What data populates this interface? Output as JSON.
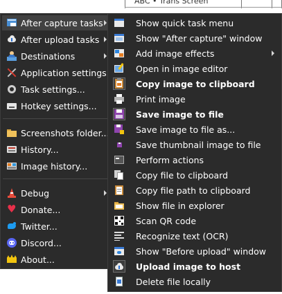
{
  "background_window": {
    "text": "ABC • Trans Screen"
  },
  "main_menu": {
    "items": [
      {
        "label": "After capture tasks",
        "icon": "after-capture-icon",
        "submenu": true
      },
      {
        "label": "After upload tasks",
        "icon": "after-upload-icon",
        "submenu": true
      },
      {
        "label": "Destinations",
        "icon": "destinations-icon",
        "submenu": true
      },
      {
        "label": "Application settings...",
        "icon": "wrench-icon"
      },
      {
        "label": "Task settings...",
        "icon": "gear-icon"
      },
      {
        "label": "Hotkey settings...",
        "icon": "keyboard-icon"
      },
      {
        "label": "Screenshots folder...",
        "icon": "folder-icon"
      },
      {
        "label": "History...",
        "icon": "history-icon"
      },
      {
        "label": "Image history...",
        "icon": "image-history-icon"
      },
      {
        "label": "Debug",
        "icon": "traffic-cone-icon",
        "submenu": true
      },
      {
        "label": "Donate...",
        "icon": "heart-icon"
      },
      {
        "label": "Twitter...",
        "icon": "twitter-bird-icon"
      },
      {
        "label": "Discord...",
        "icon": "discord-icon"
      },
      {
        "label": "About...",
        "icon": "crown-icon"
      }
    ]
  },
  "submenu": {
    "items": [
      {
        "label": "Show quick task menu",
        "icon": "quick-task-menu-icon"
      },
      {
        "label": "Show \"After capture\" window",
        "icon": "window-icon"
      },
      {
        "label": "Add image effects",
        "icon": "image-effects-icon",
        "submenu": true
      },
      {
        "label": "Open in image editor",
        "icon": "image-editor-icon"
      },
      {
        "label": "Copy image to clipboard",
        "icon": "clipboard-image-icon",
        "checked": true
      },
      {
        "label": "Print image",
        "icon": "printer-icon"
      },
      {
        "label": "Save image to file",
        "icon": "floppy-disk-icon",
        "checked": true
      },
      {
        "label": "Save image to file as...",
        "icon": "floppy-disk-as-icon"
      },
      {
        "label": "Save thumbnail image to file",
        "icon": "thumbnail-icon"
      },
      {
        "label": "Perform actions",
        "icon": "terminal-icon"
      },
      {
        "label": "Copy file to clipboard",
        "icon": "copy-file-icon"
      },
      {
        "label": "Copy file path to clipboard",
        "icon": "clipboard-path-icon"
      },
      {
        "label": "Show file in explorer",
        "icon": "explorer-folder-icon"
      },
      {
        "label": "Scan QR code",
        "icon": "qr-code-icon"
      },
      {
        "label": "Recognize text (OCR)",
        "icon": "ocr-text-icon"
      },
      {
        "label": "Show \"Before upload\" window",
        "icon": "before-upload-window-icon"
      },
      {
        "label": "Upload image to host",
        "icon": "cloud-upload-icon",
        "checked": true
      },
      {
        "label": "Delete file locally",
        "icon": "delete-file-icon"
      }
    ]
  }
}
